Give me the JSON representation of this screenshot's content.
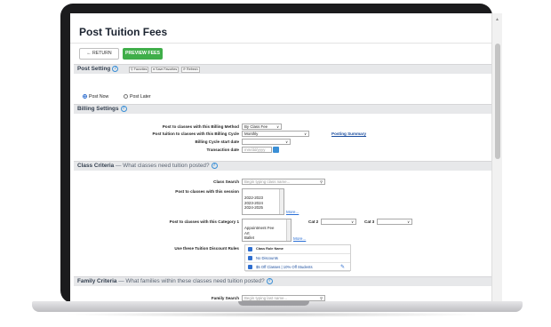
{
  "page": {
    "title": "Post Tuition Fees",
    "return_label": "← RETURN",
    "preview_label": "PREVIEW FEES"
  },
  "post_setting": {
    "title": "Post Setting",
    "favorites": "Favorites",
    "save_favorites": "Save Favorites",
    "refresh": "Refresh",
    "post_now": "Post Now",
    "post_later": "Post Later"
  },
  "billing": {
    "title": "Billing Settings",
    "method_label": "Post to classes with this Billing Method",
    "method_value": "By Class Fee",
    "cycle_label": "Post tuition to classes with this Billing Cycle",
    "cycle_value": "Monthly",
    "posting_summary": "Posting Summary",
    "start_label": "Billing Cycle start date",
    "start_value": "",
    "txn_label": "Transaction date",
    "txn_placeholder": "mm/dd/yyyy"
  },
  "class_criteria": {
    "title": "Class Criteria",
    "subtitle": "— What classes need tuition posted?",
    "search_label": "Class Search",
    "search_placeholder": "Begin typing class name...",
    "session_label": "Post to classes with this session",
    "sessions": [
      "2022-2023",
      "2023-2024",
      "2024-2025"
    ],
    "more": "More...",
    "cat1_label": "Post to classes with this Category 1",
    "cat1_items": [
      "Appointment Fee",
      "Art",
      "Ballet"
    ],
    "cat2_label": "Cat 2",
    "cat3_label": "Cat 3",
    "discount_label": "Use these Tuition Discount Rules",
    "discount_header": "Class Rule Name",
    "discount_rules": [
      "No Discounts",
      "$5 Off Classes | 10% Off Students"
    ]
  },
  "family_criteria": {
    "title": "Family Criteria",
    "subtitle": "— What families within these classes need tuition posted?",
    "search_label": "Family Search",
    "search_placeholder": "Begin typing last name..."
  },
  "colors": {
    "accent_green": "#3fae49",
    "link_blue": "#1a4d9e",
    "icon_blue": "#3a8fd6"
  }
}
